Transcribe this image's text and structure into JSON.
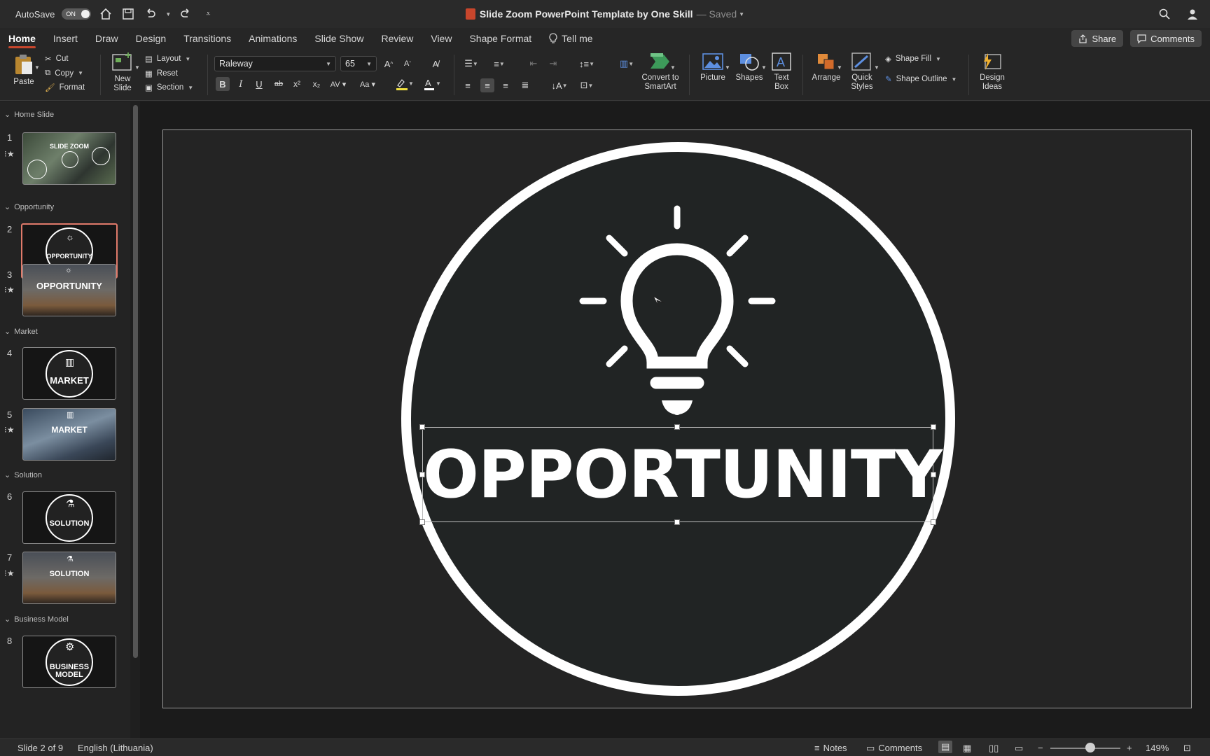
{
  "titlebar": {
    "autosave_label": "AutoSave",
    "autosave_state": "ON",
    "doc_title": "Slide Zoom PowerPoint Template by One Skill",
    "saved_label": "— Saved"
  },
  "tabs": [
    "Home",
    "Insert",
    "Draw",
    "Design",
    "Transitions",
    "Animations",
    "Slide Show",
    "Review",
    "View",
    "Shape Format"
  ],
  "tell_me": "Tell me",
  "share_label": "Share",
  "comments_label": "Comments",
  "toolbar": {
    "paste": "Paste",
    "cut": "Cut",
    "copy": "Copy",
    "format": "Format",
    "new_slide_1": "New",
    "new_slide_2": "Slide",
    "layout": "Layout",
    "reset": "Reset",
    "section": "Section",
    "font_name": "Raleway",
    "font_size": "65",
    "convert_1": "Convert to",
    "convert_2": "SmartArt",
    "picture": "Picture",
    "shapes": "Shapes",
    "textbox_1": "Text",
    "textbox_2": "Box",
    "arrange": "Arrange",
    "quick_1": "Quick",
    "quick_2": "Styles",
    "shape_fill": "Shape Fill",
    "shape_outline": "Shape Outline",
    "design_1": "Design",
    "design_2": "Ideas"
  },
  "sections": [
    {
      "name": "Home Slide"
    },
    {
      "name": "Opportunity"
    },
    {
      "name": "Market"
    },
    {
      "name": "Solution"
    },
    {
      "name": "Business Model"
    }
  ],
  "slides": [
    {
      "num": "1",
      "label": "SLIDE ZOOM"
    },
    {
      "num": "2",
      "label": "OPPORTUNITY"
    },
    {
      "num": "3",
      "label": "OPPORTUNITY"
    },
    {
      "num": "4",
      "label": "MARKET"
    },
    {
      "num": "5",
      "label": "MARKET"
    },
    {
      "num": "6",
      "label": "SOLUTION"
    },
    {
      "num": "7",
      "label": "SOLUTION"
    },
    {
      "num": "8",
      "label": "BUSINESS MODEL"
    }
  ],
  "slide_main_text": "OPPORTUNITY",
  "status": {
    "slide_info": "Slide 2 of 9",
    "language": "English (Lithuania)",
    "notes": "Notes",
    "comments": "Comments",
    "zoom": "149%"
  }
}
